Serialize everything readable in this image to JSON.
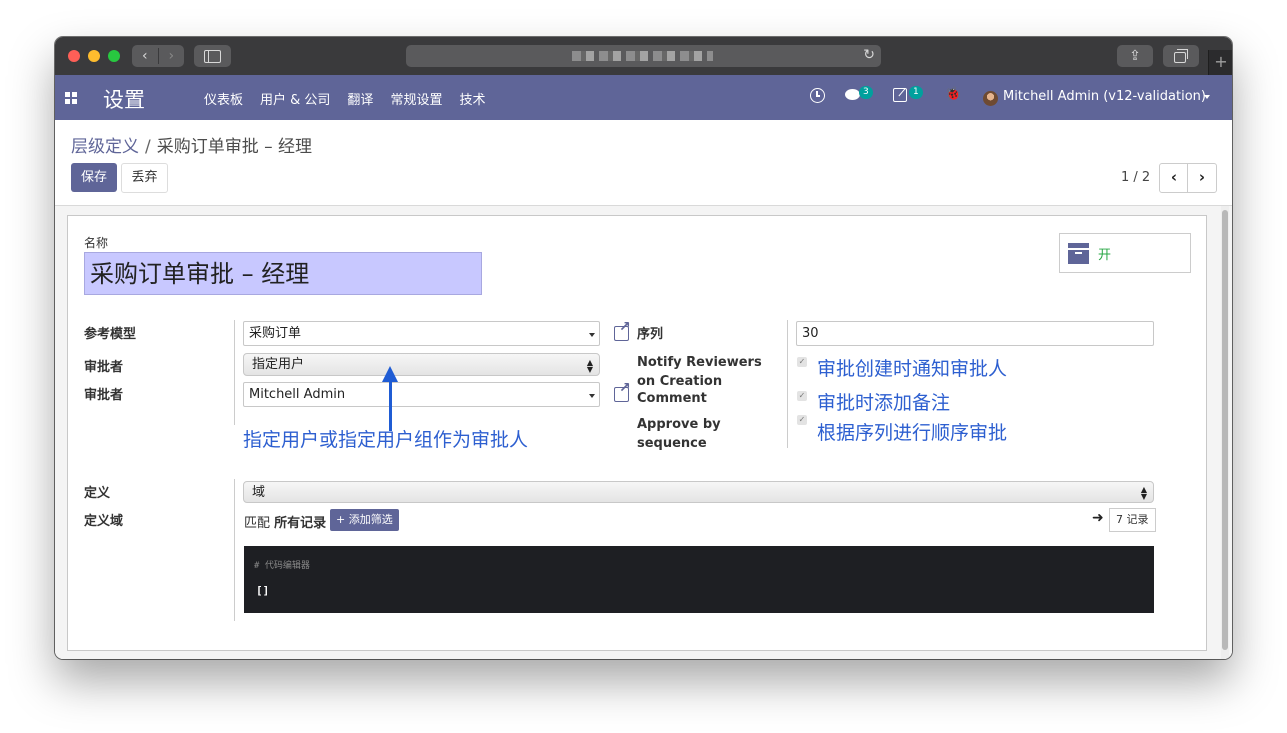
{
  "browser": {
    "back_glyph": "‹",
    "forward_glyph": "›",
    "reload_glyph": "↻",
    "share_glyph": "⇪",
    "new_tab_glyph": "+"
  },
  "navbar": {
    "app_title": "设置",
    "menu": [
      "仪表板",
      "用户 & 公司",
      "翻译",
      "常规设置",
      "技术"
    ],
    "chat_count": "3",
    "activity_count": "1",
    "bug_glyph": "🐞",
    "user_name": "Mitchell Admin (v12-validation)"
  },
  "breadcrumb": {
    "parent": "层级定义",
    "separator": "/",
    "current": "采购订单审批 – 经理"
  },
  "actions": {
    "save_label": "保存",
    "discard_label": "丢弃"
  },
  "pager": {
    "value": "1 / 2",
    "prev": "‹",
    "next": "›"
  },
  "form": {
    "name_label": "名称",
    "name_value": "采购订单审批 – 经理",
    "archive_label": "开",
    "model_label": "参考模型",
    "model_value": "采购订单",
    "reviewer_type_label": "审批者",
    "reviewer_type_value": "指定用户",
    "reviewer_label": "审批者",
    "reviewer_value": "Mitchell Admin",
    "sequence_label": "序列",
    "sequence_value": "30",
    "notify_label": "Notify Reviewers on Creation",
    "comment_label": "Comment",
    "approve_seq_label": "Approve by sequence",
    "definition_label": "定义",
    "definition_value": "域",
    "domain_label": "定义域",
    "match_prefix": "匹配",
    "match_all": "所有记录",
    "add_filter_label": "+ 添加筛选",
    "records_arrow": "➜",
    "records_label": "7 记录",
    "code_comment": "# 代码编辑器",
    "code_content": "[]"
  },
  "annotations": {
    "reviewer_hint": "指定用户或指定用户组作为审批人",
    "notify_hint": "审批创建时通知审批人",
    "comment_hint": "审批时添加备注",
    "sequence_hint": "根据序列进行顺序审批"
  },
  "colors": {
    "brand": "#5f6598",
    "annotation_blue": "#2d5fd0",
    "archive_green": "#28a745",
    "code_bg": "#1e1f23"
  }
}
